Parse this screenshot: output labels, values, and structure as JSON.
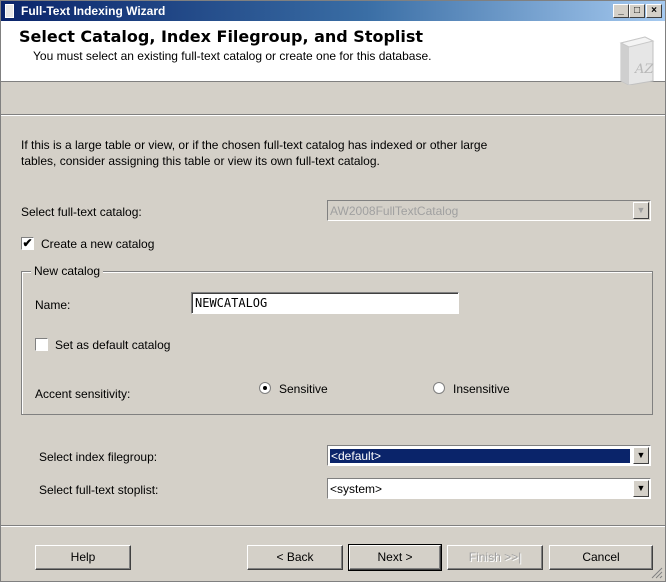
{
  "window": {
    "title": "Full-Text Indexing Wizard"
  },
  "title_buttons": {
    "minimize": "_",
    "maximize": "□",
    "close": "×"
  },
  "header": {
    "title": "Select Catalog, Index Filegroup, and Stoplist",
    "subtitle": "You must select an existing full-text catalog or create one for this database.",
    "icon": "catalog-book-icon",
    "icon_text": "AZ"
  },
  "intro": {
    "line1": "If this is a large table or view, or if the chosen full-text catalog has indexed or other large",
    "line2": "tables, consider assigning this table or view its own full-text catalog."
  },
  "catalog": {
    "label": "Select full-text catalog:",
    "value": "AW2008FullTextCatalog",
    "enabled": false
  },
  "create_new": {
    "label": "Create a new catalog",
    "checked": true,
    "check_glyph": "✔"
  },
  "new_catalog": {
    "group_label": "New catalog",
    "name_label": "Name:",
    "name_value": "NEWCATALOG",
    "default_label": "Set as default catalog",
    "default_checked": false,
    "accent_label": "Accent sensitivity:",
    "sensitive_label": "Sensitive",
    "insensitive_label": "Insensitive",
    "accent_selected": "Sensitive"
  },
  "filegroup": {
    "label": "Select index filegroup:",
    "value": "<default>"
  },
  "stoplist": {
    "label": "Select full-text stoplist:",
    "value": "<system>"
  },
  "dropdown_arrow": "▼",
  "buttons": {
    "help": "Help",
    "back": "< Back",
    "next": "Next >",
    "finish": "Finish >>|",
    "cancel": "Cancel"
  },
  "colors": {
    "title_bar": "#0a246a",
    "face": "#d4d0c8",
    "selection": "#0a246a"
  }
}
